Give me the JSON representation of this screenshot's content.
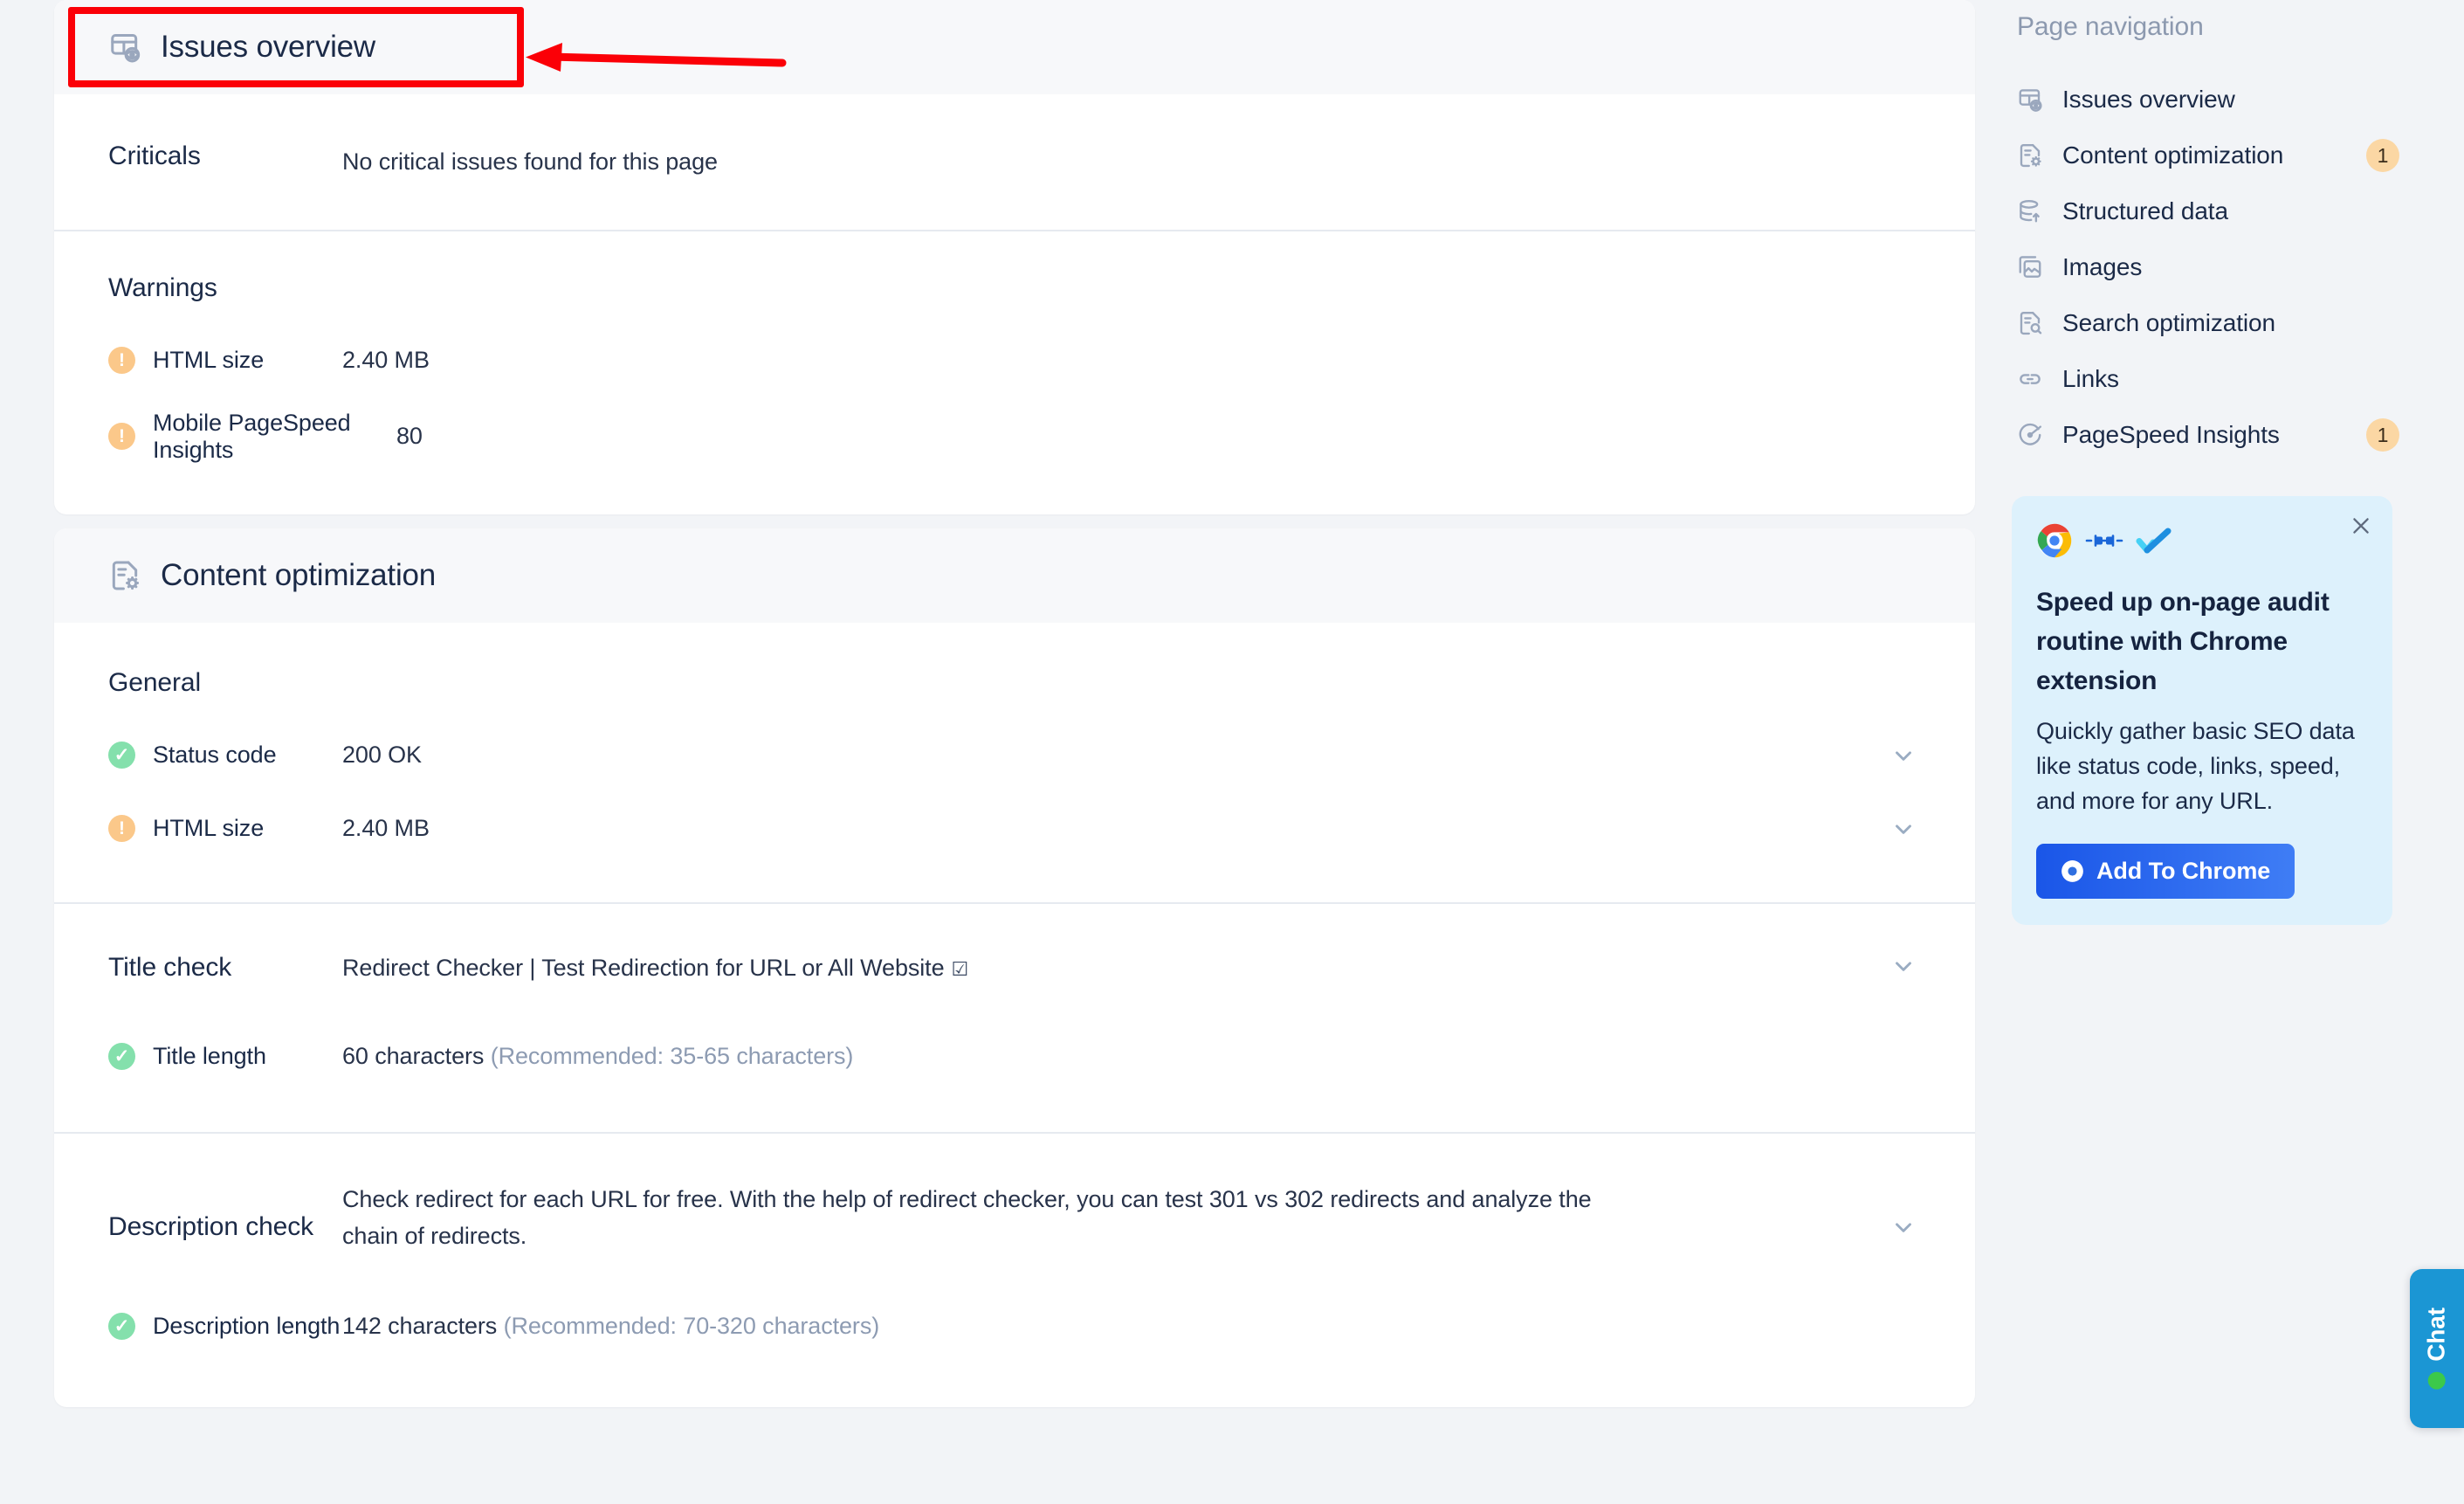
{
  "issues_overview": {
    "header": {
      "title": "Issues overview",
      "icon": "issues-overview-icon"
    },
    "criticals": {
      "label": "Criticals",
      "value": "No critical issues found for this page"
    },
    "warnings": {
      "label": "Warnings",
      "items": [
        {
          "status": "warning",
          "label": "HTML size",
          "value": "2.40 MB"
        },
        {
          "status": "warning",
          "label": "Mobile PageSpeed Insights",
          "value": "80"
        }
      ]
    }
  },
  "content_optimization": {
    "header": {
      "title": "Content optimization",
      "icon": "content-optimization-icon"
    },
    "general": {
      "label": "General",
      "items": [
        {
          "status": "good",
          "label": "Status code",
          "value": "200 OK",
          "value_style": "ok"
        },
        {
          "status": "warning",
          "label": "HTML size",
          "value": "2.40 MB",
          "value_style": "normal"
        }
      ]
    },
    "title_check": {
      "label": "Title check",
      "title_text": "Redirect Checker | Test Redirection for URL or All Website",
      "external_icon": "external-link-icon",
      "length": {
        "status": "good",
        "label": "Title length",
        "value": "60 characters",
        "hint": "(Recommended: 35-65 characters)"
      }
    },
    "description_check": {
      "label": "Description check",
      "description_text": "Check redirect for each URL for free. With the help of redirect checker, you can test 301 vs 302 redirects and analyze the chain of redirects.",
      "length": {
        "status": "good",
        "label": "Description length",
        "value": "142 characters",
        "hint": "(Recommended: 70-320 characters)"
      }
    }
  },
  "sidebar": {
    "title": "Page navigation",
    "items": [
      {
        "label": "Issues overview",
        "icon": "issues-overview-icon",
        "badge": ""
      },
      {
        "label": "Content optimization",
        "icon": "content-optimization-icon",
        "badge": "1"
      },
      {
        "label": "Structured data",
        "icon": "database-icon",
        "badge": ""
      },
      {
        "label": "Images",
        "icon": "image-icon",
        "badge": ""
      },
      {
        "label": "Search optimization",
        "icon": "search-document-icon",
        "badge": ""
      },
      {
        "label": "Links",
        "icon": "link-icon",
        "badge": ""
      },
      {
        "label": "PageSpeed Insights",
        "icon": "gauge-icon",
        "badge": "1"
      }
    ]
  },
  "promo": {
    "heading": "Speed up on-page audit routine with Chrome extension",
    "body": "Quickly gather basic SEO data like status code, links, speed, and more for any URL.",
    "button_label": "Add To Chrome",
    "close_icon": "close-icon",
    "logos": [
      "chrome-logo-icon",
      "plug-connect-icon",
      "sitechecker-check-icon"
    ]
  },
  "chat": {
    "label": "Chat",
    "status_icon": "online-dot-icon"
  },
  "colors": {
    "accent_blue": "#1a56e8",
    "warning": "#fbc88a",
    "success": "#84e0ac",
    "status_ok_text": "#6fd49b",
    "annotation_red": "#fb0007",
    "page_bg": "#f2f4f7",
    "header_band": "#f7f8fa",
    "chat_blue": "#1b96d4"
  }
}
